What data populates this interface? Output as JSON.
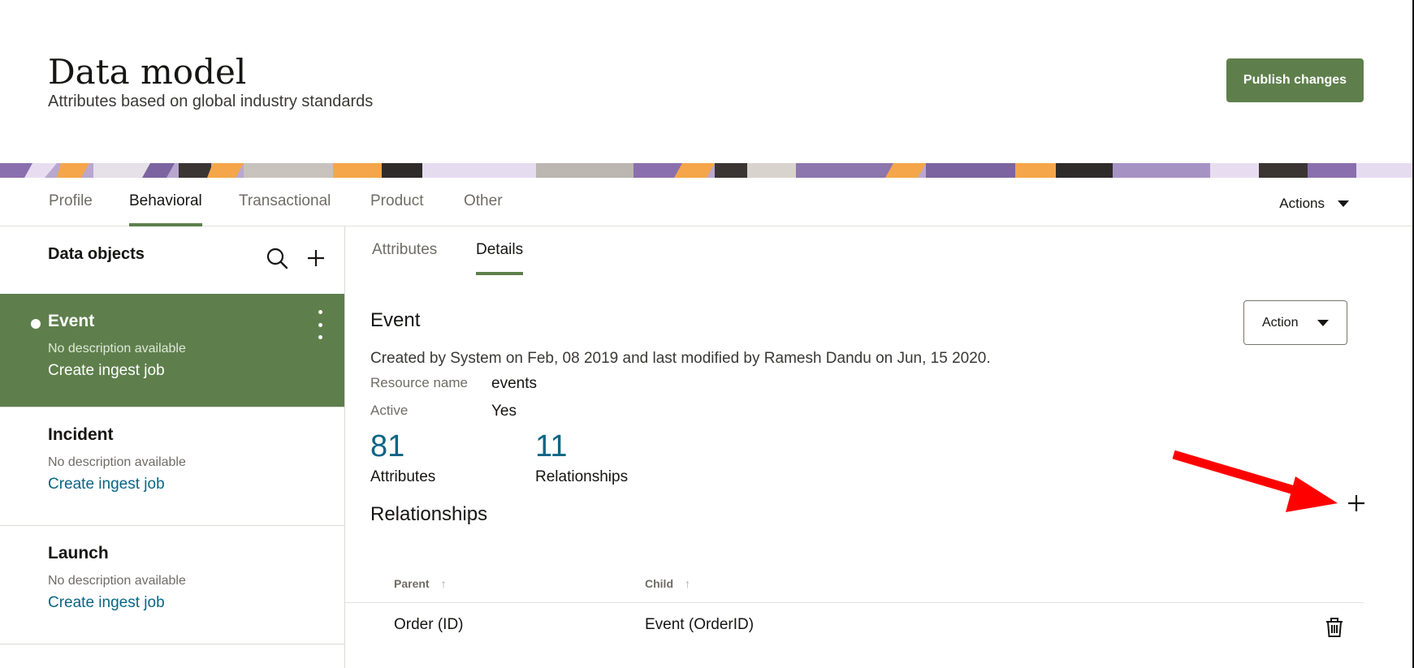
{
  "header": {
    "title": "Data model",
    "subtitle": "Attributes based on global industry standards",
    "publish_label": "Publish changes"
  },
  "tabs": [
    {
      "label": "Profile",
      "active": false
    },
    {
      "label": "Behavioral",
      "active": true
    },
    {
      "label": "Transactional",
      "active": false
    },
    {
      "label": "Product",
      "active": false
    },
    {
      "label": "Other",
      "active": false
    }
  ],
  "actions_menu": {
    "label": "Actions"
  },
  "sidebar": {
    "title": "Data objects",
    "search_icon": "search-icon",
    "add_icon": "plus-icon",
    "items": [
      {
        "name": "Event",
        "description": "No description available",
        "link": "Create ingest job",
        "selected": true
      },
      {
        "name": "Incident",
        "description": "No description available",
        "link": "Create ingest job",
        "selected": false
      },
      {
        "name": "Launch",
        "description": "No description available",
        "link": "Create ingest job",
        "selected": false
      }
    ]
  },
  "main": {
    "subtabs": [
      {
        "label": "Attributes",
        "active": false
      },
      {
        "label": "Details",
        "active": true
      }
    ],
    "object_title": "Event",
    "action_label": "Action",
    "meta": "Created by System on Feb, 08 2019 and last modified by Ramesh Dandu on Jun, 15 2020.",
    "resource_name_label": "Resource name",
    "resource_name_value": "events",
    "active_label": "Active",
    "active_value": "Yes",
    "stats": {
      "attributes_count": "81",
      "attributes_label": "Attributes",
      "relationships_count": "11",
      "relationships_label": "Relationships"
    },
    "relationships_title": "Relationships",
    "table": {
      "columns": [
        "Parent",
        "Child"
      ],
      "rows": [
        {
          "parent": "Order (ID)",
          "child": "Event (OrderID)"
        }
      ]
    }
  },
  "colors": {
    "accent": "#5e7f4c",
    "link": "#0a6584",
    "annotation_arrow": "#ff0000"
  }
}
